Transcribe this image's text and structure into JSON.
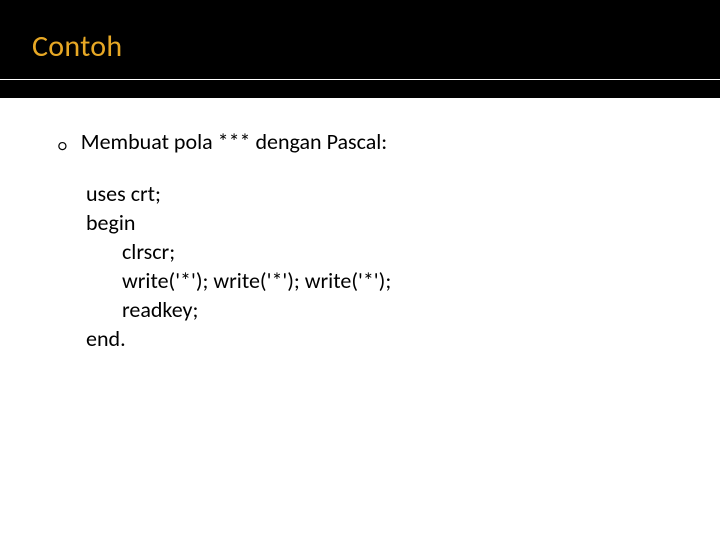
{
  "header": {
    "title": "Contoh"
  },
  "bullet": {
    "marker": "○",
    "text": "Membuat pola *** dengan Pascal:"
  },
  "code": {
    "l1": "uses crt;",
    "l2": "begin",
    "l3": "clrscr;",
    "l4": "write('*'); write('*'); write('*');",
    "l5": "readkey;",
    "l6": "end."
  }
}
